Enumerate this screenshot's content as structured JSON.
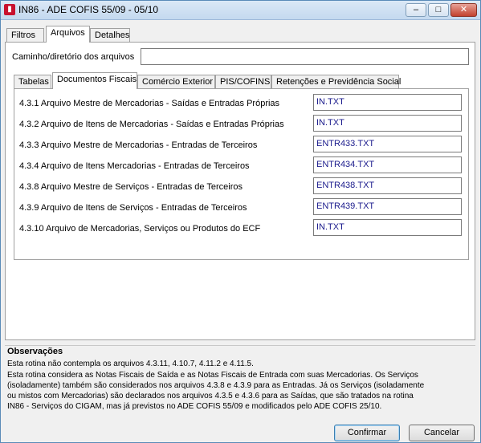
{
  "window": {
    "title": "IN86 - ADE COFIS 55/09 - 05/10",
    "icon": "app-logo-icon",
    "controls": {
      "minimize": "–",
      "maximize": "□",
      "close": "✕"
    }
  },
  "main_tabs": [
    {
      "label": "Filtros",
      "active": false
    },
    {
      "label": "Arquivos",
      "active": true
    },
    {
      "label": "Detalhes",
      "active": false
    }
  ],
  "path": {
    "label": "Caminho/diretório dos arquivos",
    "value": ""
  },
  "sub_tabs": [
    {
      "label": "Tabelas",
      "active": false
    },
    {
      "label": "Documentos Fiscais",
      "active": true
    },
    {
      "label": "Comércio Exterior",
      "active": false
    },
    {
      "label": "PIS/COFINS",
      "active": false
    },
    {
      "label": "Retenções e Previdência Social",
      "active": false
    }
  ],
  "files": [
    {
      "label": "4.3.1 Arquivo Mestre de Mercadorias - Saídas e Entradas Próprias",
      "value": "IN.TXT"
    },
    {
      "label": "4.3.2 Arquivo de Itens de Mercadorias - Saídas e Entradas Próprias",
      "value": "IN.TXT"
    },
    {
      "label": "4.3.3 Arquivo Mestre de Mercadorias - Entradas de Terceiros",
      "value": "ENTR433.TXT"
    },
    {
      "label": "4.3.4 Arquivo de Itens Mercadorias - Entradas de Terceiros",
      "value": "ENTR434.TXT"
    },
    {
      "label": "4.3.8 Arquivo Mestre de Serviços - Entradas de Terceiros",
      "value": "ENTR438.TXT"
    },
    {
      "label": "4.3.9 Arquivo de Itens de Serviços - Entradas de Terceiros",
      "value": "ENTR439.TXT"
    },
    {
      "label": "4.3.10 Arquivo de Mercadorias, Serviços ou Produtos do ECF",
      "value": "IN.TXT"
    }
  ],
  "observations": {
    "title": "Observações",
    "lines": [
      "Esta rotina não contempla os arquivos 4.3.11, 4.10.7, 4.11.2 e 4.11.5.",
      "Esta rotina considera as Notas Fiscais de Saída e as Notas Fiscais de Entrada com suas Mercadorias. Os Serviços",
      "(isoladamente) também são considerados nos arquivos 4.3.8 e 4.3.9 para as Entradas. Já os Serviços (isoladamente",
      "ou mistos com Mercadorias) são declarados nos arquivos 4.3.5 e 4.3.6 para as Saídas, que são tratados na rotina",
      "IN86 - Serviços do CIGAM, mas já previstos no ADE COFIS 55/09 e modificados pelo ADE COFIS 25/10."
    ]
  },
  "buttons": {
    "confirm": "Confirmar",
    "cancel": "Cancelar"
  }
}
